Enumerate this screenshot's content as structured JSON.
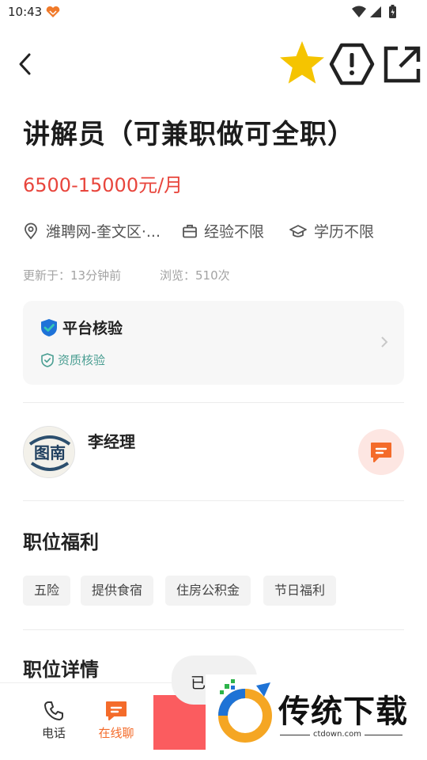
{
  "status_bar": {
    "time": "10:43"
  },
  "header": {
    "back_icon": "chevron-left-icon",
    "favorite_icon": "star-icon",
    "report_icon": "warning-octagon-icon",
    "share_icon": "share-external-icon"
  },
  "job": {
    "title": "讲解员（可兼职做可全职）",
    "salary": "6500-15000元/月",
    "location": "潍聘网-奎文区·...",
    "experience": "经验不限",
    "education": "学历不限",
    "updated": "更新于：13分钟前",
    "views": "浏览：510次"
  },
  "verification": {
    "title": "平台核验",
    "item": "资质核验"
  },
  "recruiter": {
    "name": "李经理",
    "avatar_text": "图南"
  },
  "benefits": {
    "title": "职位福利",
    "tags": [
      "五险",
      "提供食宿",
      "住房公积金",
      "节日福利"
    ]
  },
  "details": {
    "title": "职位详情"
  },
  "bottom_bar": {
    "phone_label": "电话",
    "chat_label": "在线聊"
  },
  "toast": {
    "text": "已"
  },
  "watermark": {
    "brand": "传统下载",
    "url": "ctdown.com"
  },
  "colors": {
    "salary": "#e8453c",
    "star": "#f5c400",
    "accent": "#f46b2a",
    "apply": "#fb5c5f",
    "verify": "#4a9e92"
  }
}
